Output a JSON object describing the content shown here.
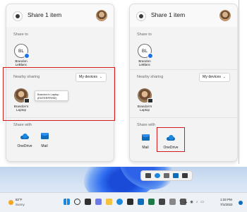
{
  "share_dialog_left": {
    "title": "Share 1 item",
    "share_to_label": "Share to",
    "contact": {
      "initials": "BL",
      "name_line1": "Brandon",
      "name_line2": "LeBlanc"
    },
    "nearby_label": "Nearby sharing",
    "nearby_dropdown": "My devices",
    "device": {
      "name_line1": "Brandon's",
      "name_line2": "Laptop"
    },
    "tooltip_line1": "Brandon's Laptop",
    "tooltip_line2": "(ENTERPRISE)",
    "share_with_label": "Share with",
    "apps": [
      {
        "label": "OneDrive",
        "icon": "onedrive-icon"
      },
      {
        "label": "Mail",
        "icon": "mail-icon"
      }
    ]
  },
  "share_dialog_right": {
    "title": "Share 1 item",
    "share_to_label": "Share to",
    "contact": {
      "initials": "BL",
      "name_line1": "Brandon",
      "name_line2": "LeBlanc"
    },
    "nearby_label": "Nearby sharing",
    "nearby_dropdown": "My devices",
    "device": {
      "name_line1": "Brandon's",
      "name_line2": "Laptop"
    },
    "share_with_label": "Share with",
    "apps": [
      {
        "label": "Mail",
        "icon": "mail-icon"
      },
      {
        "label": "OneDrive",
        "icon": "onedrive-icon"
      }
    ]
  },
  "taskbar": {
    "weather_temp": "82°F",
    "weather_condition": "Sunny",
    "clock_time": "1:33 PM",
    "clock_date": "7/1/2022"
  },
  "colors": {
    "highlight": "#d51c1c",
    "accent": "#0f6cbd"
  }
}
